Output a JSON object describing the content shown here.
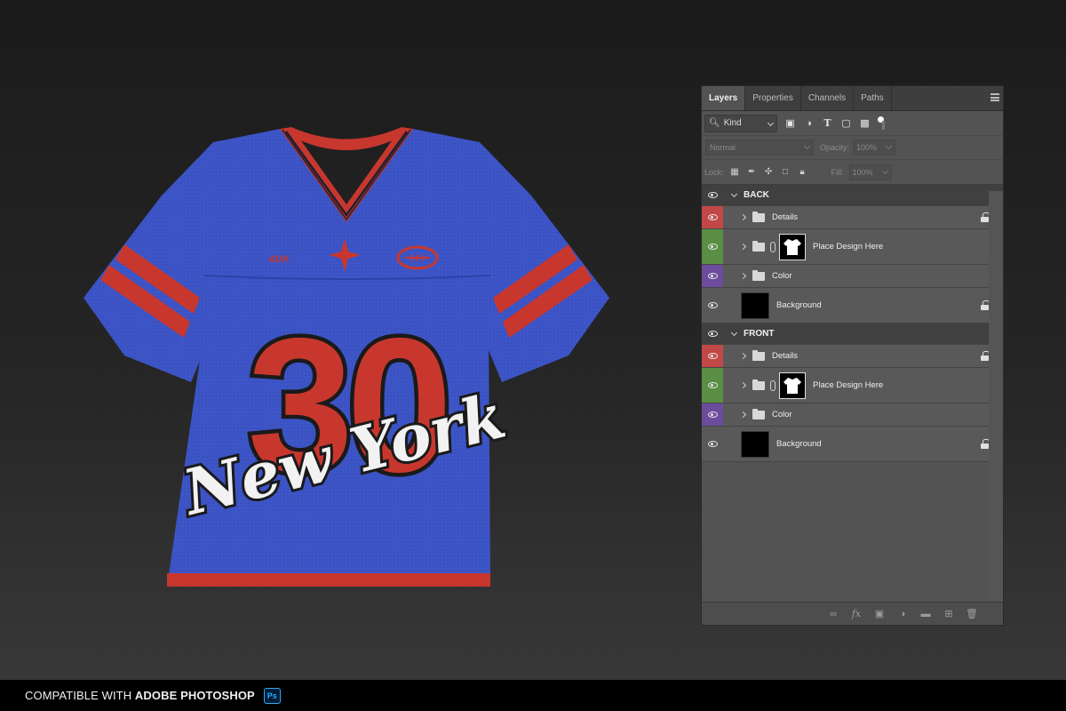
{
  "jersey": {
    "number": "30",
    "script_text": "New York",
    "crest_text": "ADK",
    "colors": {
      "body": "#3d55c6",
      "accent": "#c8372e",
      "stripe_dark": "#1f1f2e",
      "script_fill": "#f2f2f2"
    }
  },
  "panel": {
    "tabs": [
      "Layers",
      "Properties",
      "Channels",
      "Paths"
    ],
    "active_tab": "Layers",
    "filter": {
      "label": "Kind",
      "icons": [
        "image-filter-icon",
        "adjustment-filter-icon",
        "type-filter-icon",
        "shape-filter-icon",
        "smart-object-filter-icon"
      ]
    },
    "blend_mode": "Normal",
    "opacity_label": "Opacity:",
    "opacity_value": "100%",
    "lock_label": "Lock:",
    "fill_label": "Fill:",
    "fill_value": "100%",
    "groups": [
      {
        "name": "BACK",
        "layers": [
          {
            "name": "Details",
            "type": "folder",
            "color": "red",
            "locked": true
          },
          {
            "name": "Place Design Here",
            "type": "smart",
            "color": "green",
            "locked": false
          },
          {
            "name": "Color",
            "type": "folder",
            "color": "purple",
            "locked": false
          },
          {
            "name": "Background",
            "type": "bg",
            "color": "none",
            "locked": true
          }
        ]
      },
      {
        "name": "FRONT",
        "layers": [
          {
            "name": "Details",
            "type": "folder",
            "color": "red",
            "locked": true
          },
          {
            "name": "Place Design Here",
            "type": "smart",
            "color": "green",
            "locked": false
          },
          {
            "name": "Color",
            "type": "folder",
            "color": "purple",
            "locked": false
          },
          {
            "name": "Background",
            "type": "bg",
            "color": "none",
            "locked": true
          }
        ]
      }
    ],
    "bottom_icons": [
      "link-layers-icon",
      "fx-icon",
      "add-mask-icon",
      "adjustment-layer-icon",
      "new-group-icon",
      "new-layer-icon",
      "delete-icon"
    ]
  },
  "footer": {
    "prefix": "COMPATIBLE WITH ",
    "app": "ADOBE PHOTOSHOP",
    "badge": "Ps"
  }
}
